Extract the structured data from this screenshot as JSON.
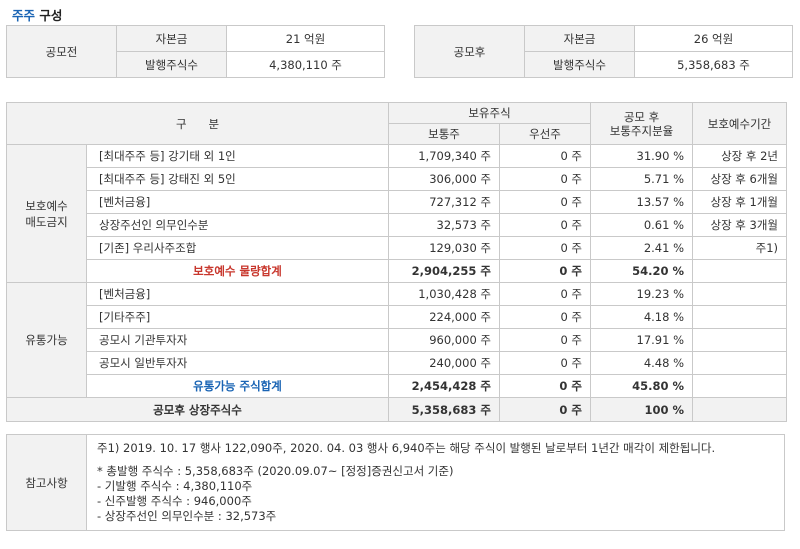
{
  "title": {
    "highlight": "주주",
    "rest": "구성"
  },
  "before_ipo": {
    "label": "공모전",
    "rows": [
      {
        "label": "자본금",
        "value": "21 억원"
      },
      {
        "label": "발행주식수",
        "value": "4,380,110 주"
      }
    ]
  },
  "after_ipo": {
    "label": "공모후",
    "rows": [
      {
        "label": "자본금",
        "value": "26 억원"
      },
      {
        "label": "발행주식수",
        "value": "5,358,683 주"
      }
    ]
  },
  "table": {
    "headers": {
      "category": "구      분",
      "holdings": "보유주식",
      "common": "보통주",
      "preferred": "우선주",
      "ratio": "공모 후\n보통주지분율",
      "lockup": "보호예수기간"
    },
    "groups": [
      {
        "label": "보호예수\n매도금지",
        "rows": [
          {
            "name": "[최대주주 등] 강기태 외 1인",
            "common": "1,709,340 주",
            "preferred": "0 주",
            "ratio": "31.90 %",
            "lockup": "상장 후 2년"
          },
          {
            "name": "[최대주주 등] 강태진 외 5인",
            "common": "306,000 주",
            "preferred": "0 주",
            "ratio": "5.71 %",
            "lockup": "상장 후 6개월"
          },
          {
            "name": "[벤처금융]",
            "common": "727,312 주",
            "preferred": "0 주",
            "ratio": "13.57 %",
            "lockup": "상장 후 1개월"
          },
          {
            "name": "상장주선인 의무인수분",
            "common": "32,573 주",
            "preferred": "0 주",
            "ratio": "0.61 %",
            "lockup": "상장 후 3개월"
          },
          {
            "name": "[기존] 우리사주조합",
            "common": "129,030 주",
            "preferred": "0 주",
            "ratio": "2.41 %",
            "lockup": "주1)"
          }
        ],
        "subtotal": {
          "name": "보호예수 물량합계",
          "common": "2,904,255 주",
          "preferred": "0 주",
          "ratio": "54.20 %",
          "lockup": ""
        }
      },
      {
        "label": "유통가능",
        "rows": [
          {
            "name": "[벤처금융]",
            "common": "1,030,428 주",
            "preferred": "0 주",
            "ratio": "19.23 %",
            "lockup": ""
          },
          {
            "name": "[기타주주]",
            "common": "224,000 주",
            "preferred": "0 주",
            "ratio": "4.18 %",
            "lockup": ""
          },
          {
            "name": "공모시 기관투자자",
            "common": "960,000 주",
            "preferred": "0 주",
            "ratio": "17.91 %",
            "lockup": ""
          },
          {
            "name": "공모시 일반투자자",
            "common": "240,000 주",
            "preferred": "0 주",
            "ratio": "4.48 %",
            "lockup": ""
          }
        ],
        "subtotal": {
          "name": "유통가능 주식합계",
          "common": "2,454,428 주",
          "preferred": "0 주",
          "ratio": "45.80 %",
          "lockup": ""
        }
      }
    ],
    "total": {
      "name": "공모후 상장주식수",
      "common": "5,358,683 주",
      "preferred": "0 주",
      "ratio": "100 %",
      "lockup": ""
    }
  },
  "notes": {
    "label": "참고사항",
    "line1": "주1) 2019. 10. 17 행사 122,090주, 2020. 04. 03 행사 6,940주는 해당 주식이 발행된 날로부터 1년간 매각이 제한됩니다.",
    "bullets": [
      "* 총발행 주식수 : 5,358,683주 (2020.09.07~ [정정]증권신고서 기준)",
      "- 기발행 주식수 : 4,380,110주",
      "- 신주발행 주식수 : 946,000주",
      "- 상장주선인 의무인수분 : 32,573주"
    ]
  },
  "colors": {
    "accent_blue": "#1a64b4",
    "accent_red": "#c8372d",
    "header_bg": "#f2f2f2",
    "border": "#c9c9c9"
  }
}
